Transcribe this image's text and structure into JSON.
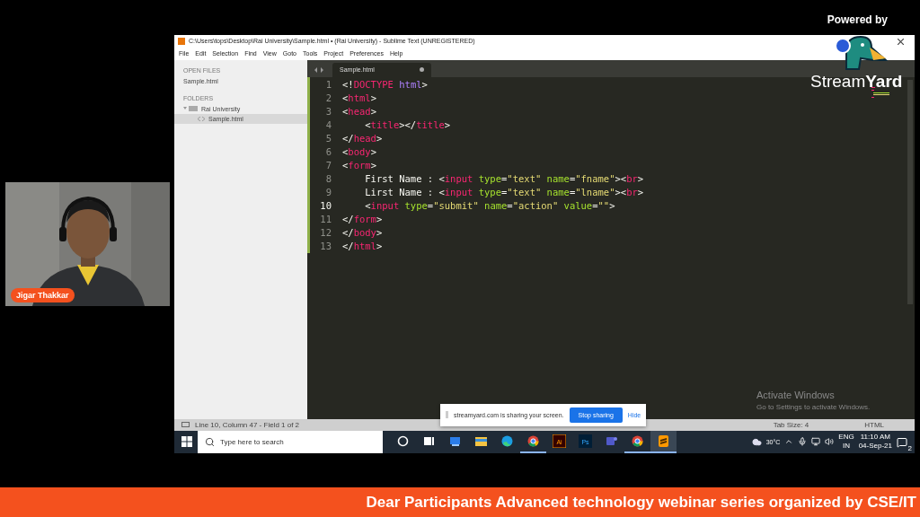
{
  "overlay": {
    "powered_by": "Powered by",
    "logo_text": "Stream**Yard**"
  },
  "webcam": {
    "kind": "picture",
    "name_tag": "Jigar Thakkar"
  },
  "window": {
    "title": "C:\\Users\\tops\\Desktop\\Rai University\\Sample.html • (Rai University) - Sublime Text (UNREGISTERED)",
    "menu": [
      "File",
      "Edit",
      "Selection",
      "Find",
      "View",
      "Goto",
      "Tools",
      "Project",
      "Preferences",
      "Help"
    ]
  },
  "sidebar": {
    "open_files_heading": "OPEN FILES",
    "open_files": [
      {
        "label": "Sample.html"
      }
    ],
    "folders_heading": "FOLDERS",
    "folders": [
      {
        "label": "Rai University",
        "expanded": true,
        "children": [
          {
            "label": "Sample.html",
            "selected": true
          }
        ]
      }
    ]
  },
  "tabs": [
    {
      "label": "Sample.html",
      "selected": true,
      "modified": true
    }
  ],
  "editor": {
    "lines": [
      {
        "number": "1",
        "current": false,
        "tokens": [
          {
            "kind": "punct",
            "text": "<!"
          },
          {
            "kind": "tag",
            "text": "DOCTYPE"
          },
          {
            "kind": "keyword",
            "text": " html"
          },
          {
            "kind": "punct",
            "text": ">"
          }
        ]
      },
      {
        "number": "2",
        "current": false,
        "tokens": [
          {
            "kind": "punct",
            "text": "<"
          },
          {
            "kind": "tag",
            "text": "html"
          },
          {
            "kind": "punct",
            "text": ">"
          }
        ]
      },
      {
        "number": "3",
        "current": false,
        "tokens": [
          {
            "kind": "punct",
            "text": "<"
          },
          {
            "kind": "tag",
            "text": "head"
          },
          {
            "kind": "punct",
            "text": ">"
          }
        ]
      },
      {
        "number": "4",
        "current": false,
        "tokens": [
          {
            "kind": "punct",
            "text": "    <"
          },
          {
            "kind": "tag",
            "text": "title"
          },
          {
            "kind": "punct",
            "text": "></"
          },
          {
            "kind": "tag",
            "text": "title"
          },
          {
            "kind": "punct",
            "text": ">"
          }
        ]
      },
      {
        "number": "5",
        "current": false,
        "tokens": [
          {
            "kind": "punct",
            "text": "</"
          },
          {
            "kind": "tag",
            "text": "head"
          },
          {
            "kind": "punct",
            "text": ">"
          }
        ]
      },
      {
        "number": "6",
        "current": false,
        "tokens": [
          {
            "kind": "punct",
            "text": "<"
          },
          {
            "kind": "tag",
            "text": "body"
          },
          {
            "kind": "punct",
            "text": ">"
          }
        ]
      },
      {
        "number": "7",
        "current": false,
        "tokens": [
          {
            "kind": "punct",
            "text": "<"
          },
          {
            "kind": "tag",
            "text": "form"
          },
          {
            "kind": "punct",
            "text": ">"
          }
        ]
      },
      {
        "number": "8",
        "current": false,
        "tokens": [
          {
            "kind": "punct",
            "text": "    First Name : <"
          },
          {
            "kind": "tag",
            "text": "input"
          },
          {
            "kind": "attr",
            "text": " type"
          },
          {
            "kind": "punct",
            "text": "="
          },
          {
            "kind": "string",
            "text": "\"text\""
          },
          {
            "kind": "attr",
            "text": " name"
          },
          {
            "kind": "punct",
            "text": "="
          },
          {
            "kind": "string",
            "text": "\"fname\""
          },
          {
            "kind": "punct",
            "text": "><"
          },
          {
            "kind": "tag",
            "text": "br"
          },
          {
            "kind": "punct",
            "text": ">"
          }
        ]
      },
      {
        "number": "9",
        "current": false,
        "tokens": [
          {
            "kind": "punct",
            "text": "    Lirst Name : <"
          },
          {
            "kind": "tag",
            "text": "input"
          },
          {
            "kind": "attr",
            "text": " type"
          },
          {
            "kind": "punct",
            "text": "="
          },
          {
            "kind": "string",
            "text": "\"text\""
          },
          {
            "kind": "attr",
            "text": " name"
          },
          {
            "kind": "punct",
            "text": "="
          },
          {
            "kind": "string",
            "text": "\"lname\""
          },
          {
            "kind": "punct",
            "text": "><"
          },
          {
            "kind": "tag",
            "text": "br"
          },
          {
            "kind": "punct",
            "text": ">"
          }
        ]
      },
      {
        "number": "10",
        "current": true,
        "tokens": [
          {
            "kind": "punct",
            "text": "    <"
          },
          {
            "kind": "tag",
            "text": "input"
          },
          {
            "kind": "attr",
            "text": " type"
          },
          {
            "kind": "punct",
            "text": "="
          },
          {
            "kind": "string",
            "text": "\"submit\""
          },
          {
            "kind": "attr",
            "text": " name"
          },
          {
            "kind": "punct",
            "text": "="
          },
          {
            "kind": "string",
            "text": "\"action\""
          },
          {
            "kind": "attr",
            "text": " value"
          },
          {
            "kind": "punct",
            "text": "="
          },
          {
            "kind": "string",
            "text": "\"\""
          },
          {
            "kind": "punct",
            "text": ">"
          }
        ]
      },
      {
        "number": "11",
        "current": false,
        "tokens": [
          {
            "kind": "punct",
            "text": "</"
          },
          {
            "kind": "tag",
            "text": "form"
          },
          {
            "kind": "punct",
            "text": ">"
          }
        ]
      },
      {
        "number": "12",
        "current": false,
        "tokens": [
          {
            "kind": "punct",
            "text": "</"
          },
          {
            "kind": "tag",
            "text": "body"
          },
          {
            "kind": "punct",
            "text": ">"
          }
        ]
      },
      {
        "number": "13",
        "current": false,
        "tokens": [
          {
            "kind": "punct",
            "text": "</"
          },
          {
            "kind": "tag",
            "text": "html"
          },
          {
            "kind": "punct",
            "text": ">"
          }
        ]
      }
    ]
  },
  "activation_notice": {
    "title": "Activate Windows",
    "subtitle": "Go to Settings to activate Windows."
  },
  "share_bar": {
    "message": "streamyard.com is sharing your screen.",
    "stop_button": "Stop sharing",
    "hide_link": "Hide"
  },
  "status_bar": {
    "position": "Line 10, Column 47 - Field 1 of 2",
    "tab_size": "Tab Size: 4",
    "syntax": "HTML"
  },
  "taskbar": {
    "search_placeholder": "Type here to search",
    "apps": [
      {
        "kind": "cortana",
        "running": false,
        "selected": false
      },
      {
        "kind": "taskview",
        "running": false,
        "selected": false
      },
      {
        "kind": "app",
        "running": false,
        "selected": false
      },
      {
        "kind": "explorer",
        "running": false,
        "selected": false
      },
      {
        "kind": "edge",
        "running": false,
        "selected": false
      },
      {
        "kind": "chrome",
        "running": true,
        "selected": false
      },
      {
        "kind": "illustrator",
        "label": "Ai",
        "running": false,
        "selected": false
      },
      {
        "kind": "photoshop",
        "label": "Ps",
        "running": false,
        "selected": false
      },
      {
        "kind": "teams",
        "running": false,
        "selected": false
      },
      {
        "kind": "chrome",
        "running": true,
        "selected": false
      },
      {
        "kind": "sublime",
        "running": true,
        "selected": true
      }
    ],
    "weather": "30°C",
    "language": "ENG",
    "region": "IN",
    "time": "11:10 AM",
    "date": "04-Sep-21",
    "notifications": "2"
  },
  "banner": {
    "text": "Dear Participants Advanced technology webinar series organized by CSE/IT"
  }
}
